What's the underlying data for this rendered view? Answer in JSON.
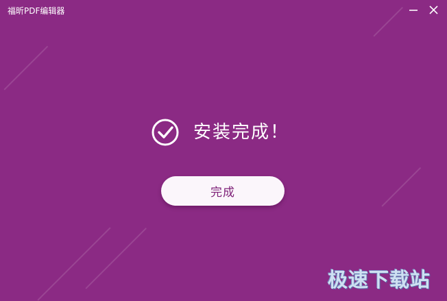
{
  "window": {
    "title": "福昕PDF编辑器",
    "background_color": "#8b2a84"
  },
  "titlebar": {
    "minimize_icon": "minimize-icon",
    "close_icon": "close-icon"
  },
  "status": {
    "icon": "check-circle-icon",
    "text": "安装完成！"
  },
  "finish_button": {
    "label": "完成"
  },
  "watermark": {
    "text": "极速下载站"
  }
}
